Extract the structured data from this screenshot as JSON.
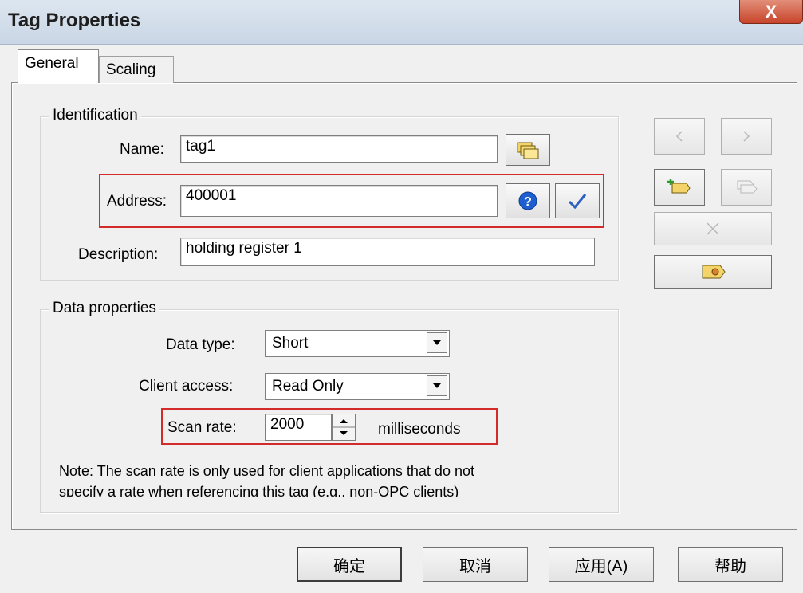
{
  "window": {
    "title": "Tag Properties",
    "close_label": "X"
  },
  "tabs": [
    {
      "label": "General"
    },
    {
      "label": "Scaling"
    }
  ],
  "identification": {
    "group_label": "Identification",
    "name_label": "Name:",
    "name_value": "tag1",
    "address_label": "Address:",
    "address_value": "400001",
    "description_label": "Description:",
    "description_value": "holding register 1"
  },
  "data_properties": {
    "group_label": "Data properties",
    "data_type_label": "Data type:",
    "data_type_value": "Short",
    "client_access_label": "Client access:",
    "client_access_value": "Read Only",
    "scan_rate_label": "Scan rate:",
    "scan_rate_value": "2000",
    "scan_rate_unit": "milliseconds",
    "note_line1": "Note: The scan rate is only used for client applications that do not",
    "note_line2": "specify a rate when referencing this tag (e.g., non-OPC clients)"
  },
  "buttons": {
    "ok": "确定",
    "cancel": "取消",
    "apply": "应用(A)",
    "help": "帮助"
  },
  "colors": {
    "highlight_box": "#d32a2a",
    "check_blue": "#2c5fbf",
    "help_blue": "#1d5fd1"
  }
}
